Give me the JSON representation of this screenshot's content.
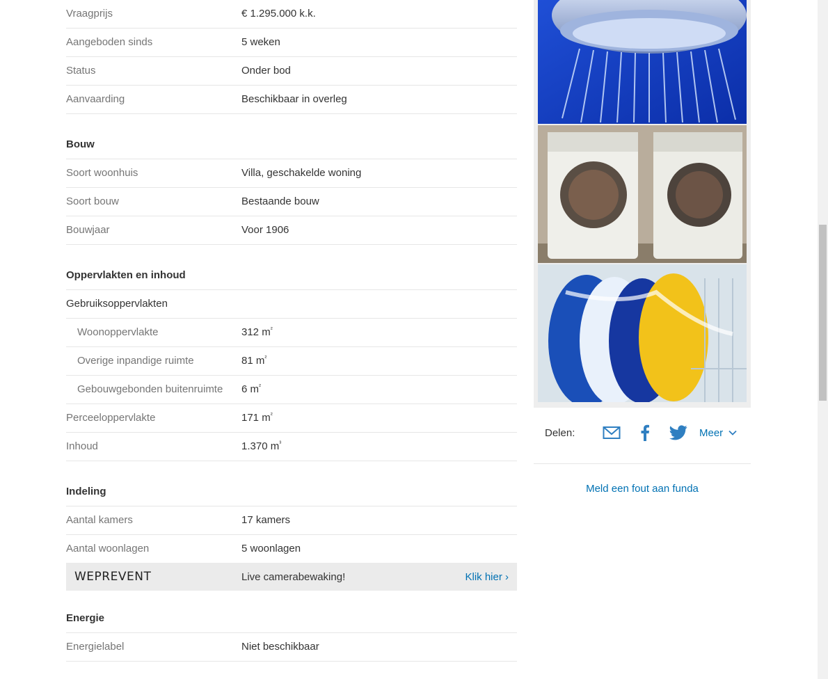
{
  "overdracht": [
    {
      "label": "Vraagprijs",
      "value": "€ 1.295.000 k.k."
    },
    {
      "label": "Aangeboden sinds",
      "value": "5 weken"
    },
    {
      "label": "Status",
      "value": "Onder bod"
    },
    {
      "label": "Aanvaarding",
      "value": "Beschikbaar in overleg"
    }
  ],
  "bouw": {
    "title": "Bouw",
    "rows": [
      {
        "label": "Soort woonhuis",
        "value": "Villa, geschakelde woning"
      },
      {
        "label": "Soort bouw",
        "value": "Bestaande bouw"
      },
      {
        "label": "Bouwjaar",
        "value": "Voor 1906"
      }
    ]
  },
  "oppervlakten": {
    "title": "Oppervlakten en inhoud",
    "group_label": "Gebruiksoppervlakten",
    "sub_rows": [
      {
        "label": "Woonoppervlakte",
        "value": "312 m",
        "unit_sup": "²"
      },
      {
        "label": "Overige inpandige ruimte",
        "value": "81 m",
        "unit_sup": "²"
      },
      {
        "label": "Gebouwgebonden buitenruimte",
        "value": "6 m",
        "unit_sup": "²"
      }
    ],
    "rows": [
      {
        "label": "Perceeloppervlakte",
        "value": "171 m",
        "unit_sup": "²"
      },
      {
        "label": "Inhoud",
        "value": "1.370 m",
        "unit_sup": "³"
      }
    ]
  },
  "indeling": {
    "title": "Indeling",
    "rows": [
      {
        "label": "Aantal kamers",
        "value": "17 kamers"
      },
      {
        "label": "Aantal woonlagen",
        "value": "5 woonlagen"
      }
    ]
  },
  "ad": {
    "logo": "WEPREVENT",
    "slogan": "Live camerabewaking!",
    "cta": "Klik hier ›"
  },
  "energie": {
    "title": "Energie",
    "rows": [
      {
        "label": "Energielabel",
        "value": "Niet beschikbaar"
      }
    ]
  },
  "share": {
    "label": "Delen:",
    "more": "Meer"
  },
  "report_link": "Meld een fout aan funda"
}
